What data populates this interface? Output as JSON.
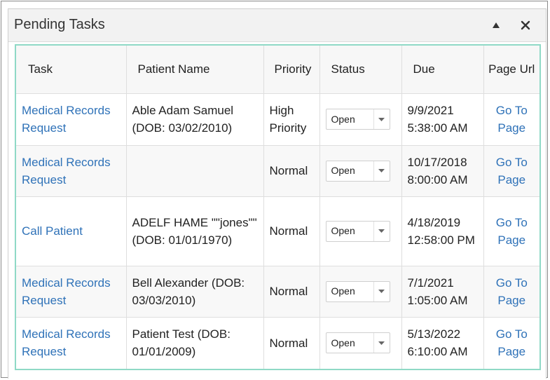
{
  "panel": {
    "title": "Pending Tasks",
    "collapse_icon": "triangle-up-icon",
    "close_icon": "close-icon"
  },
  "columns": [
    "Task",
    "Patient Name",
    "Priority",
    "Status",
    "Due",
    "Page Url"
  ],
  "rows": [
    {
      "task": "Medical Records Request",
      "patient": "Able Adam Samuel (DOB: 03/02/2010)",
      "priority": "High Priority",
      "status": "Open",
      "due": "9/9/2021 5:38:00 AM",
      "url": "Go To Page"
    },
    {
      "task": "Medical Records Request",
      "patient": "",
      "priority": "Normal",
      "status": "Open",
      "due": "10/17/2018 8:00:00 AM",
      "url": "Go To Page"
    },
    {
      "task": "Call Patient",
      "patient": "ADELF HAME \"\"jones\"\" (DOB: 01/01/1970)",
      "priority": "Normal",
      "status": "Open",
      "due": "4/18/2019 12:58:00 PM",
      "url": "Go To Page"
    },
    {
      "task": "Medical Records Request",
      "patient": "Bell Alexander (DOB: 03/03/2010)",
      "priority": "Normal",
      "status": "Open",
      "due": "7/1/2021 1:05:00 AM",
      "url": "Go To Page"
    },
    {
      "task": "Medical Records Request",
      "patient": "Patient Test (DOB: 01/01/2009)",
      "priority": "Normal",
      "status": "Open",
      "due": "5/13/2022 6:10:00 AM",
      "url": "Go To Page"
    }
  ],
  "colors": {
    "link": "#2f72b8",
    "grid_border": "#8fd9c6",
    "header_bg": "#f2f2f2"
  }
}
